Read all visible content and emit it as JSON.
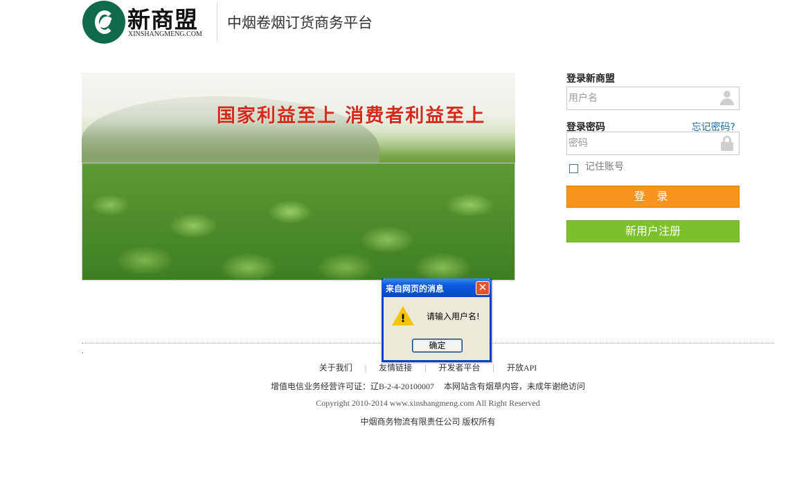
{
  "header": {
    "logo_cn": "新商盟",
    "logo_en": "XINSHANGMENG.COM",
    "site_title": "中烟卷烟订货商务平台"
  },
  "banner": {
    "slogan": "国家利益至上  消费者利益至上"
  },
  "login": {
    "title": "登录新商盟",
    "username_placeholder": "用户名",
    "username_value": "",
    "password_label": "登录密码",
    "password_placeholder": "密码",
    "password_value": "",
    "forgot_link": "忘记密码?",
    "remember_label": "记住账号",
    "remember_checked": false,
    "login_button": "登 录",
    "register_button": "新用户注册",
    "colors": {
      "login": "#f7941d",
      "register": "#7cc12b",
      "link": "#1e6ea8"
    }
  },
  "footer": {
    "dot": ".",
    "links": [
      "关于我们",
      "友情链接",
      "开发者平台",
      "开放API"
    ],
    "separator": "|",
    "license": "增值电信业务经营许可证：辽B-2-4-20100007",
    "notice": "本网站含有烟草内容，未成年谢绝访问",
    "copyright": "Copyright 2010-2014 www.xinshangmeng.com All Right Reserved",
    "company": "中烟商务物流有限责任公司  版权所有"
  },
  "dialog": {
    "title": "来自网页的消息",
    "close_icon": "close-icon",
    "warning_icon": "warning-icon",
    "message": "请输入用户名!",
    "ok_button": "确定"
  }
}
